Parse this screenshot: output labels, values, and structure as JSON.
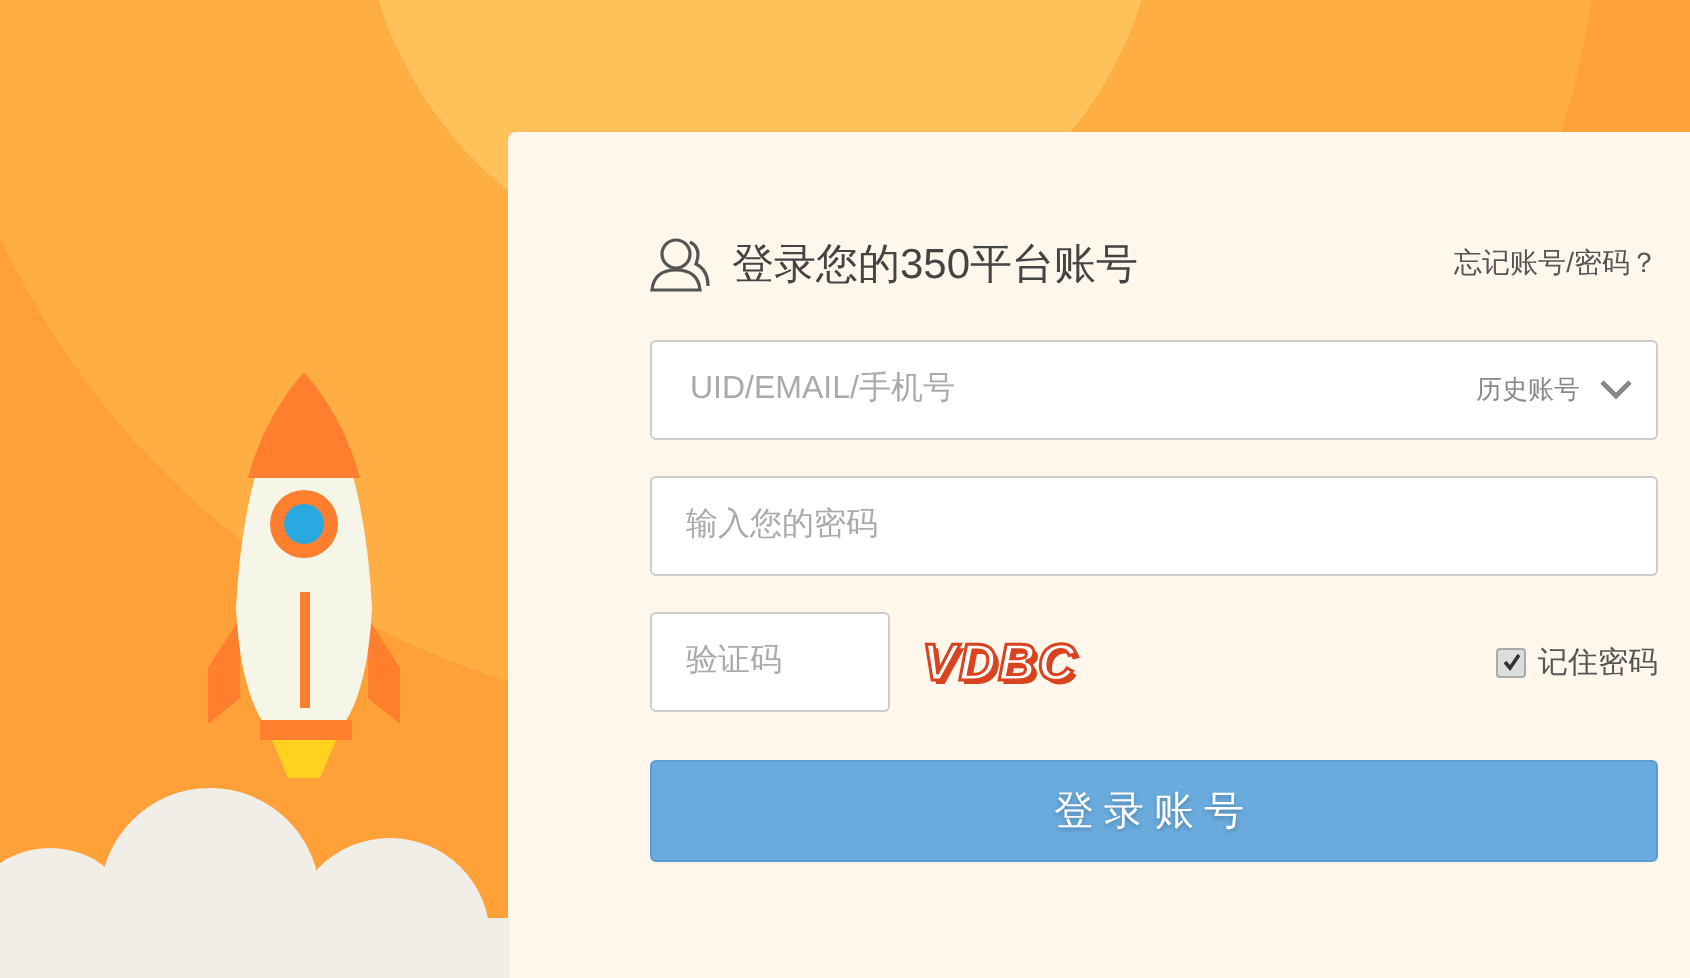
{
  "login": {
    "title": "登录您的350平台账号",
    "forgot_link": "忘记账号/密码？",
    "account_field": {
      "placeholder": "UID/EMAIL/手机号",
      "history_label": "历史账号"
    },
    "password_field": {
      "placeholder": "输入您的密码"
    },
    "captcha_field": {
      "placeholder": "验证码"
    },
    "captcha": "VDBC",
    "remember": {
      "label": "记住密码",
      "checked": true
    },
    "submit": "登录账号"
  }
}
